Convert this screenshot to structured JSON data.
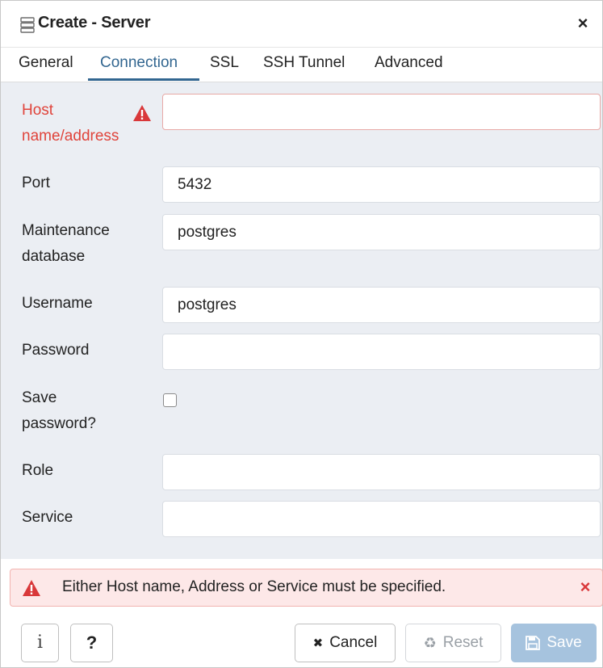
{
  "dialog": {
    "title": "Create - Server",
    "close_glyph": "×"
  },
  "tabs": [
    {
      "label": "General",
      "active": false
    },
    {
      "label": "Connection",
      "active": true
    },
    {
      "label": "SSL",
      "active": false
    },
    {
      "label": "SSH Tunnel",
      "active": false
    },
    {
      "label": "Advanced",
      "active": false
    }
  ],
  "form": {
    "host": {
      "label_line1": "Host",
      "label_line2": "name/address",
      "value": "",
      "has_error": true
    },
    "port": {
      "label": "Port",
      "value": "5432"
    },
    "maintenance_db": {
      "label_line1": "Maintenance",
      "label_line2": "database",
      "value": "postgres"
    },
    "username": {
      "label": "Username",
      "value": "postgres"
    },
    "password": {
      "label": "Password",
      "value": ""
    },
    "save_password": {
      "label_line1": "Save",
      "label_line2": "password?",
      "checked": false
    },
    "role": {
      "label": "Role",
      "value": ""
    },
    "service": {
      "label": "Service",
      "value": ""
    }
  },
  "error_banner": {
    "message": "Either Host name, Address or Service must be specified.",
    "close_glyph": "×"
  },
  "footer": {
    "info_glyph": "i",
    "help_glyph": "?",
    "cancel_label": "Cancel",
    "cancel_glyph": "✖",
    "reset_label": "Reset",
    "reset_glyph": "♻",
    "save_label": "Save"
  },
  "colors": {
    "accent": "#326690",
    "error": "#e0443b",
    "body_bg": "#ebeef3",
    "banner_bg": "#fde8e8",
    "save_disabled": "#a6c3de"
  },
  "icons": {
    "title": "server-icon",
    "field_warning": "warning-triangle-icon",
    "banner_warning": "warning-triangle-icon",
    "info": "info-icon",
    "help": "question-mark-icon",
    "cancel": "close-icon",
    "reset": "recycle-icon",
    "save": "floppy-disk-icon"
  }
}
